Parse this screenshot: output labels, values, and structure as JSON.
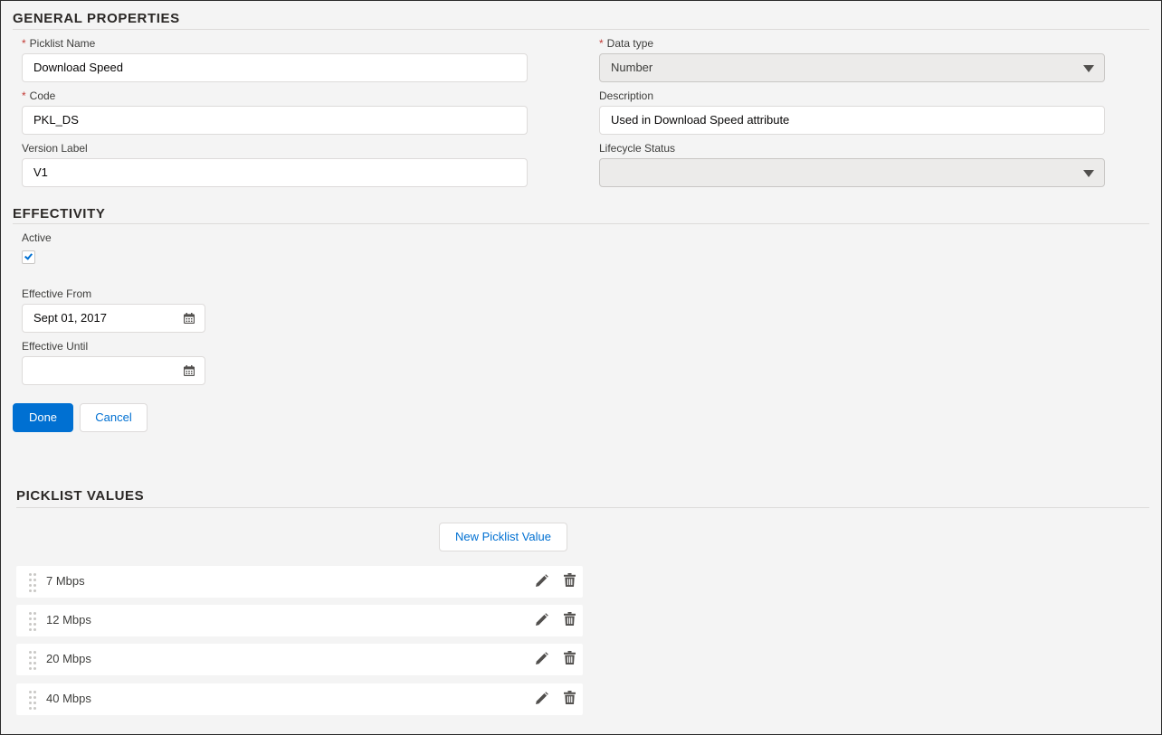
{
  "general": {
    "title": "GENERAL PROPERTIES",
    "picklist_name": {
      "label": "Picklist Name",
      "required": "*",
      "value": "Download Speed"
    },
    "code": {
      "label": "Code",
      "required": "*",
      "value": "PKL_DS"
    },
    "version_label": {
      "label": "Version Label",
      "value": "V1"
    },
    "data_type": {
      "label": "Data type",
      "required": "*",
      "value": "Number"
    },
    "description": {
      "label": "Description",
      "value": "Used in Download Speed attribute"
    },
    "lifecycle_status": {
      "label": "Lifecycle Status",
      "value": ""
    }
  },
  "effectivity": {
    "title": "EFFECTIVITY",
    "active": {
      "label": "Active",
      "checked": true
    },
    "effective_from": {
      "label": "Effective From",
      "value": "Sept 01, 2017"
    },
    "effective_until": {
      "label": "Effective Until",
      "value": ""
    }
  },
  "actions": {
    "done_label": "Done",
    "cancel_label": "Cancel"
  },
  "picklist_values": {
    "title": "PICKLIST VALUES",
    "new_button_label": "New Picklist Value",
    "items": [
      {
        "label": "7 Mbps"
      },
      {
        "label": "12 Mbps"
      },
      {
        "label": "20 Mbps"
      },
      {
        "label": "40 Mbps"
      }
    ]
  },
  "icons": {
    "calendar": "calendar-icon",
    "dropdown": "chevron-down-icon",
    "edit": "pencil-icon",
    "delete": "trash-icon",
    "drag": "drag-handle-icon"
  },
  "colors": {
    "brand": "#0070d2",
    "required": "#c23934",
    "background": "#f4f4f4"
  }
}
